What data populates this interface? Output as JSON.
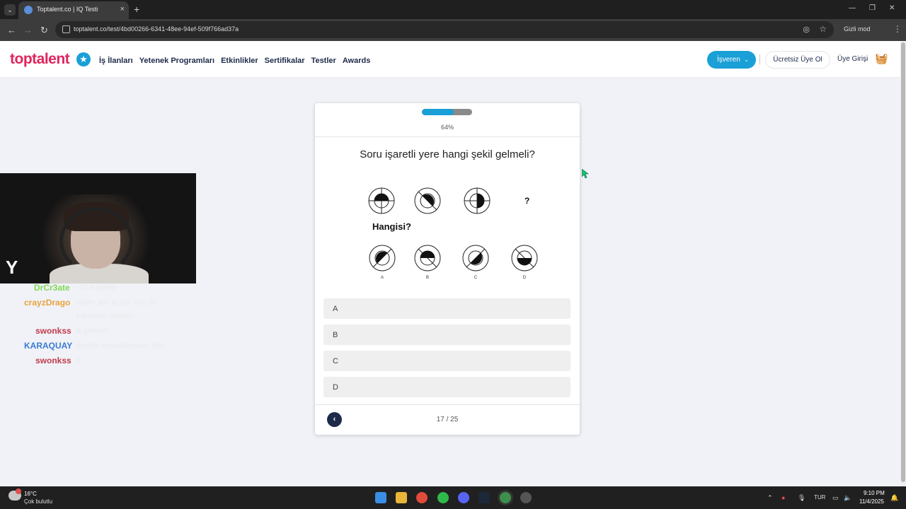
{
  "browser": {
    "tab_title": "Toptalent.co | IQ Testi",
    "tab_close": "×",
    "new_tab": "+",
    "url": "toptalent.co/test/4bd00266-6341-48ee-94ef-509f766ad37a",
    "incognito_label": "Gizli mod",
    "window_controls": [
      "—",
      "❐",
      "✕"
    ]
  },
  "site": {
    "logo": "toptalent",
    "nav": [
      "İş İlanları",
      "Yetenek Programları",
      "Etkinlikler",
      "Sertifikalar",
      "Testler",
      "Awards"
    ],
    "employer_button": "İşveren",
    "signup_button": "Ücretsiz Üye Ol",
    "login_link": "Üye Girişi"
  },
  "quiz": {
    "progress_percent": 64,
    "progress_label": "64%",
    "question": "Soru işaretli yere hangi şekil gelmeli?",
    "question_mark": "?",
    "which_label": "Hangisi?",
    "figure_option_labels": [
      "A",
      "B",
      "C",
      "D"
    ],
    "answers": [
      "A",
      "B",
      "C",
      "D"
    ],
    "counter": "17 / 25"
  },
  "chat": [
    {
      "user": "DrCr3ate",
      "color": "#7ed957",
      "message": "~118 geliyo"
    },
    {
      "user": "crayzDrago",
      "color": "#e8a33d",
      "message": "zaten asıl iq var onu da",
      "message2": "karalıyor: başarır"
    },
    {
      "user": "swonkss",
      "color": "#c23a4a",
      "message": "a gelmeli"
    },
    {
      "user": "KARAQUAY",
      "color": "#3a7bd5",
      "message": "gecide koyamayacak gibi"
    },
    {
      "user": "swonkss",
      "color": "#c23a4a",
      "message": "b"
    }
  ],
  "taskbar": {
    "temperature": "16°C",
    "condition": "Çok bulutlu",
    "language": "TUR",
    "time": "9:10 PM",
    "date": "11/4/2025"
  }
}
